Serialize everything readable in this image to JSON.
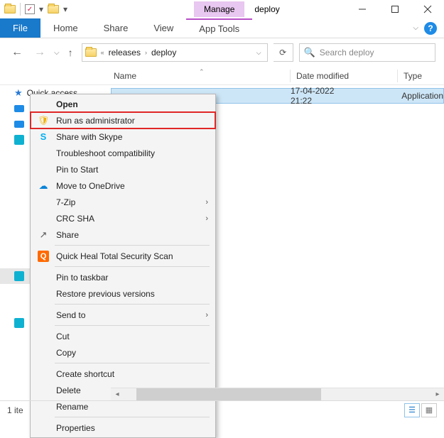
{
  "window": {
    "manage_tab": "Manage",
    "title": "deploy"
  },
  "ribbon": {
    "file": "File",
    "home": "Home",
    "share": "Share",
    "view": "View",
    "apptools": "App Tools"
  },
  "address": {
    "crumbs": [
      "releases",
      "deploy"
    ]
  },
  "search": {
    "placeholder": "Search deploy"
  },
  "columns": {
    "name": "Name",
    "date_modified": "Date modified",
    "type": "Type"
  },
  "file_row": {
    "date_modified": "17-04-2022 21:22",
    "type": "Application"
  },
  "sidebar": {
    "quick_access": "Quick access"
  },
  "context_menu": {
    "open": "Open",
    "run_admin": "Run as administrator",
    "skype": "Share with Skype",
    "troubleshoot": "Troubleshoot compatibility",
    "pin_start": "Pin to Start",
    "onedrive": "Move to OneDrive",
    "seven_zip": "7-Zip",
    "crc": "CRC SHA",
    "share": "Share",
    "quickheal": "Quick Heal Total Security Scan",
    "pin_taskbar": "Pin to taskbar",
    "restore": "Restore previous versions",
    "send_to": "Send to",
    "cut": "Cut",
    "copy": "Copy",
    "shortcut": "Create shortcut",
    "delete": "Delete",
    "rename": "Rename",
    "properties": "Properties"
  },
  "status": {
    "text": "1 ite"
  }
}
